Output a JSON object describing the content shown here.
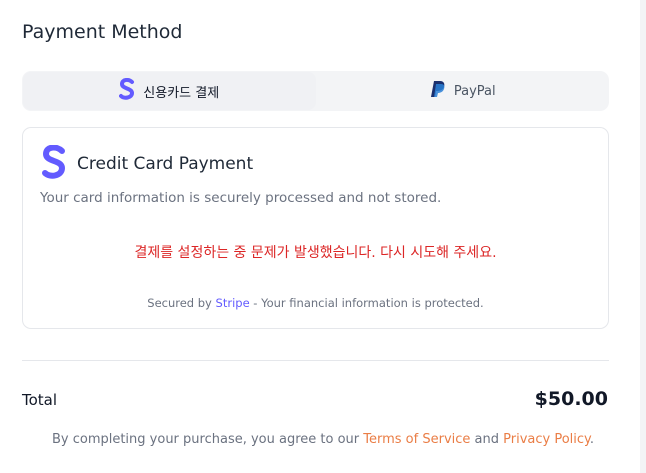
{
  "payment": {
    "heading": "Payment Method",
    "tabs": [
      {
        "label": "신용카드 결제",
        "icon": "stripe-icon",
        "active": true
      },
      {
        "label": "PayPal",
        "icon": "paypal-icon",
        "active": false
      }
    ],
    "card": {
      "title": "Credit Card Payment",
      "description": "Your card information is securely processed and not stored.",
      "error": "결제를 설정하는 중 문제가 발생했습니다. 다시 시도해 주세요.",
      "footer_prefix": "Secured by ",
      "footer_link": "Stripe",
      "footer_suffix": " - Your financial information is protected."
    }
  },
  "summary": {
    "total_label": "Total",
    "total_value": "$50.00"
  },
  "terms": {
    "prefix": "By completing your purchase, you agree to our ",
    "tos": "Terms of Service",
    "and": " and ",
    "privacy": "Privacy Policy",
    "suffix": "."
  },
  "colors": {
    "stripe": "#635bff",
    "error": "#dc2626",
    "link": "#ea7d45"
  }
}
